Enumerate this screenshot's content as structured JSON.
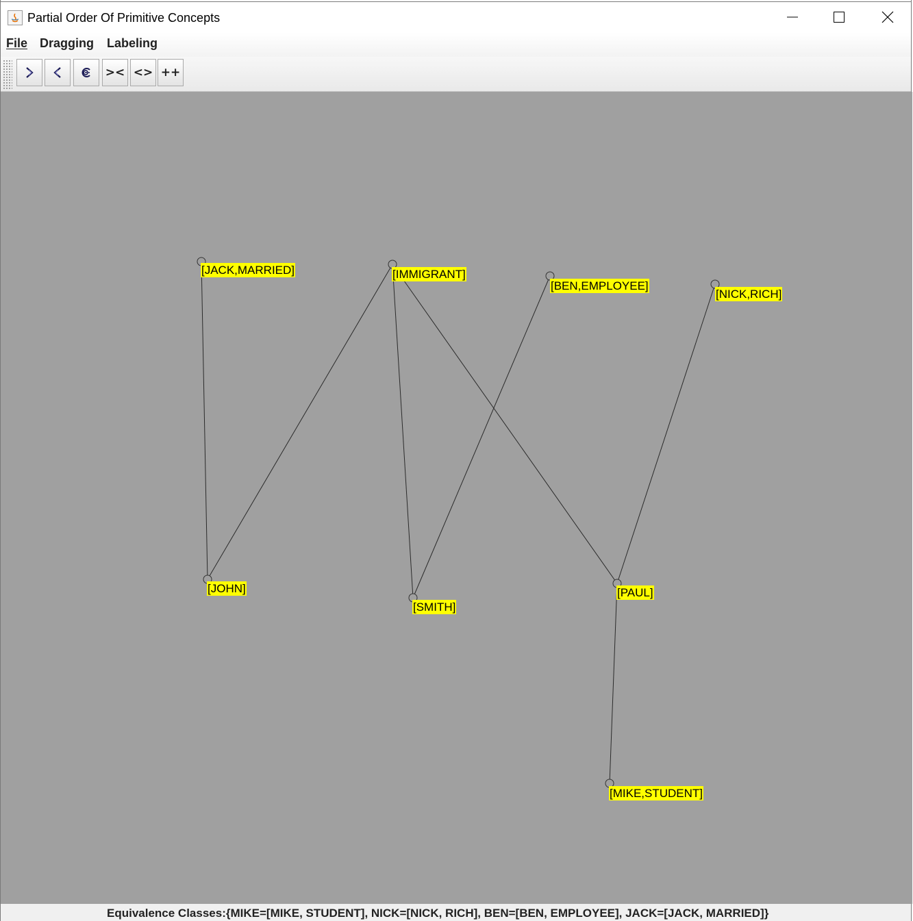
{
  "window": {
    "title": "Partial Order Of Primitive Concepts",
    "controls": [
      "minimize-icon",
      "maximize-icon",
      "close-icon"
    ]
  },
  "menu": {
    "file": "File",
    "dragging": "Dragging",
    "labeling": "Labeling"
  },
  "toolbar": {
    "buttons": [
      {
        "icon": "arrow-right-icon"
      },
      {
        "icon": "arrow-left-icon"
      },
      {
        "icon": "rotate-icon"
      },
      {
        "label": "><"
      },
      {
        "label": "<>"
      },
      {
        "label": "++"
      }
    ]
  },
  "graph": {
    "nodes": {
      "jack_married": "[JACK,MARRIED]",
      "immigrant": "[IMMIGRANT]",
      "ben_employee": "[BEN,EMPLOYEE]",
      "nick_rich": "[NICK,RICH]",
      "john": "[JOHN]",
      "smith": "[SMITH]",
      "paul": "[PAUL]",
      "mike_student": "[MIKE,STUDENT]"
    },
    "edges": [
      [
        "jack_married",
        "john"
      ],
      [
        "immigrant",
        "john"
      ],
      [
        "immigrant",
        "smith"
      ],
      [
        "immigrant",
        "paul"
      ],
      [
        "ben_employee",
        "smith"
      ],
      [
        "nick_rich",
        "paul"
      ],
      [
        "paul",
        "mike_student"
      ]
    ],
    "colors": {
      "background": "#a0a0a0",
      "label": "#ffff00",
      "edge": "#2a2a2a"
    }
  },
  "status": {
    "text": "Equivalence Classes:{MIKE=[MIKE, STUDENT], NICK=[NICK, RICH], BEN=[BEN, EMPLOYEE], JACK=[JACK, MARRIED]}"
  }
}
